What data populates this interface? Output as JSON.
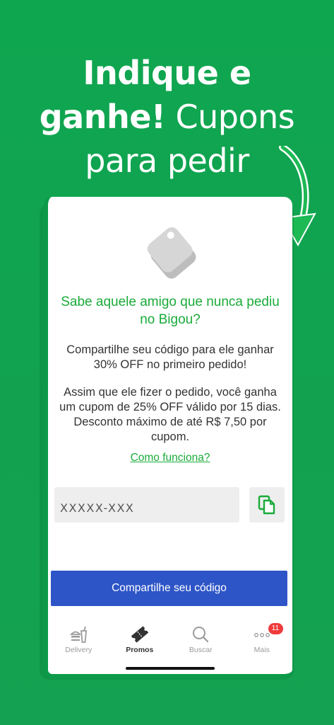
{
  "headline": {
    "bold_line1": "Indique e",
    "bold_line2": "ganhe!",
    "light_line2": "Cupons",
    "light_line3": "para pedir"
  },
  "card": {
    "title": "Sabe aquele amigo que nunca pediu no Bigou?",
    "paragraph1": "Compartilhe seu código para ele ganhar 30% OFF no primeiro pedido!",
    "paragraph2": "Assim que ele fizer o pedido, você ganha um cupom de 25% OFF válido por 15 dias. Desconto máximo de até R$ 7,50 por cupom.",
    "how_link": "Como funciona?",
    "code_value": "XXXXX-XXX",
    "share_button": "Compartilhe seu código"
  },
  "tabbar": {
    "tabs": [
      {
        "label": "Delivery",
        "icon": "burger-drink-icon",
        "active": false
      },
      {
        "label": "Promos",
        "icon": "ticket-icon",
        "active": true
      },
      {
        "label": "Buscar",
        "icon": "search-icon",
        "active": false
      },
      {
        "label": "Mais",
        "icon": "more-dots-icon",
        "active": false
      }
    ],
    "mais_badge": "11"
  },
  "colors": {
    "background": "#0fa650",
    "accent_green": "#1aab3a",
    "button_blue": "#2e55c7",
    "badge_red": "#ef3b3b"
  }
}
